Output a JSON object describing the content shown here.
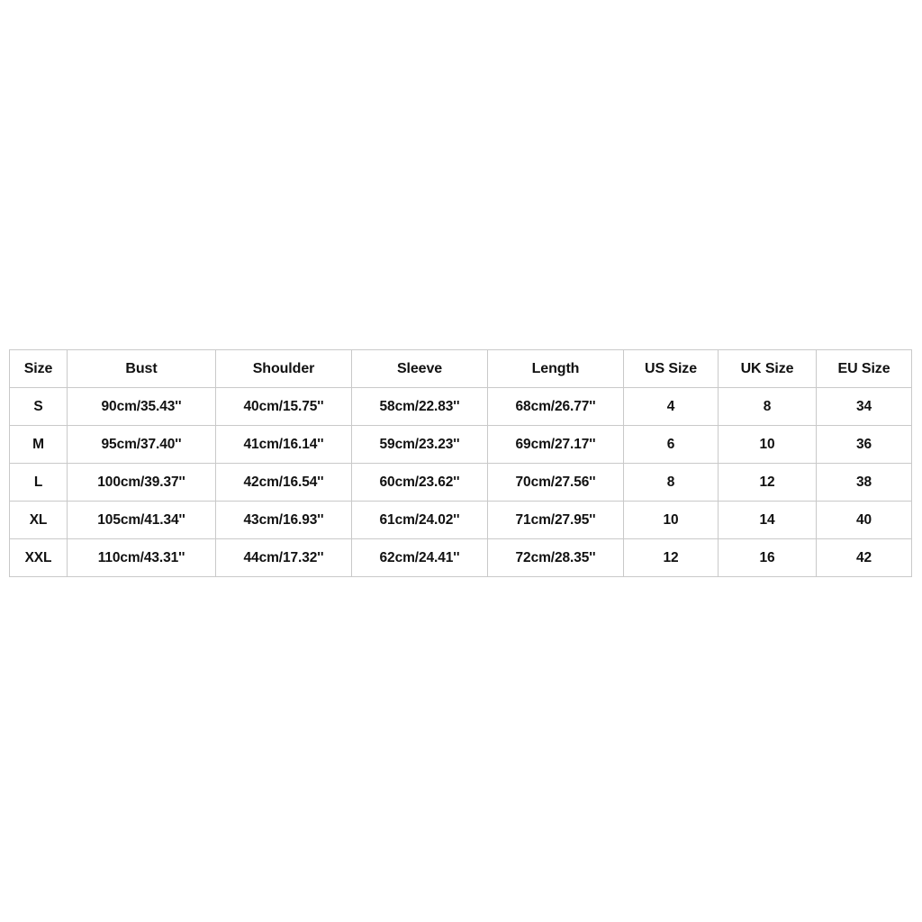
{
  "page": {
    "background_color": "#ffffff",
    "text_color": "#111111",
    "border_color": "#c9c9c9"
  },
  "size_chart": {
    "columns": [
      "Size",
      "Bust",
      "Shoulder",
      "Sleeve",
      "Length",
      "US Size",
      "UK Size",
      "EU Size"
    ],
    "rows": [
      {
        "size": "S",
        "bust": "90cm/35.43''",
        "shoulder": "40cm/15.75''",
        "sleeve": "58cm/22.83''",
        "length": "68cm/26.77''",
        "us_size": "4",
        "uk_size": "8",
        "eu_size": "34"
      },
      {
        "size": "M",
        "bust": "95cm/37.40''",
        "shoulder": "41cm/16.14''",
        "sleeve": "59cm/23.23''",
        "length": "69cm/27.17''",
        "us_size": "6",
        "uk_size": "10",
        "eu_size": "36"
      },
      {
        "size": "L",
        "bust": "100cm/39.37''",
        "shoulder": "42cm/16.54''",
        "sleeve": "60cm/23.62''",
        "length": "70cm/27.56''",
        "us_size": "8",
        "uk_size": "12",
        "eu_size": "38"
      },
      {
        "size": "XL",
        "bust": "105cm/41.34''",
        "shoulder": "43cm/16.93''",
        "sleeve": "61cm/24.02''",
        "length": "71cm/27.95''",
        "us_size": "10",
        "uk_size": "14",
        "eu_size": "40"
      },
      {
        "size": "XXL",
        "bust": "110cm/43.31''",
        "shoulder": "44cm/17.32''",
        "sleeve": "62cm/24.41''",
        "length": "72cm/28.35''",
        "us_size": "12",
        "uk_size": "16",
        "eu_size": "42"
      }
    ]
  }
}
